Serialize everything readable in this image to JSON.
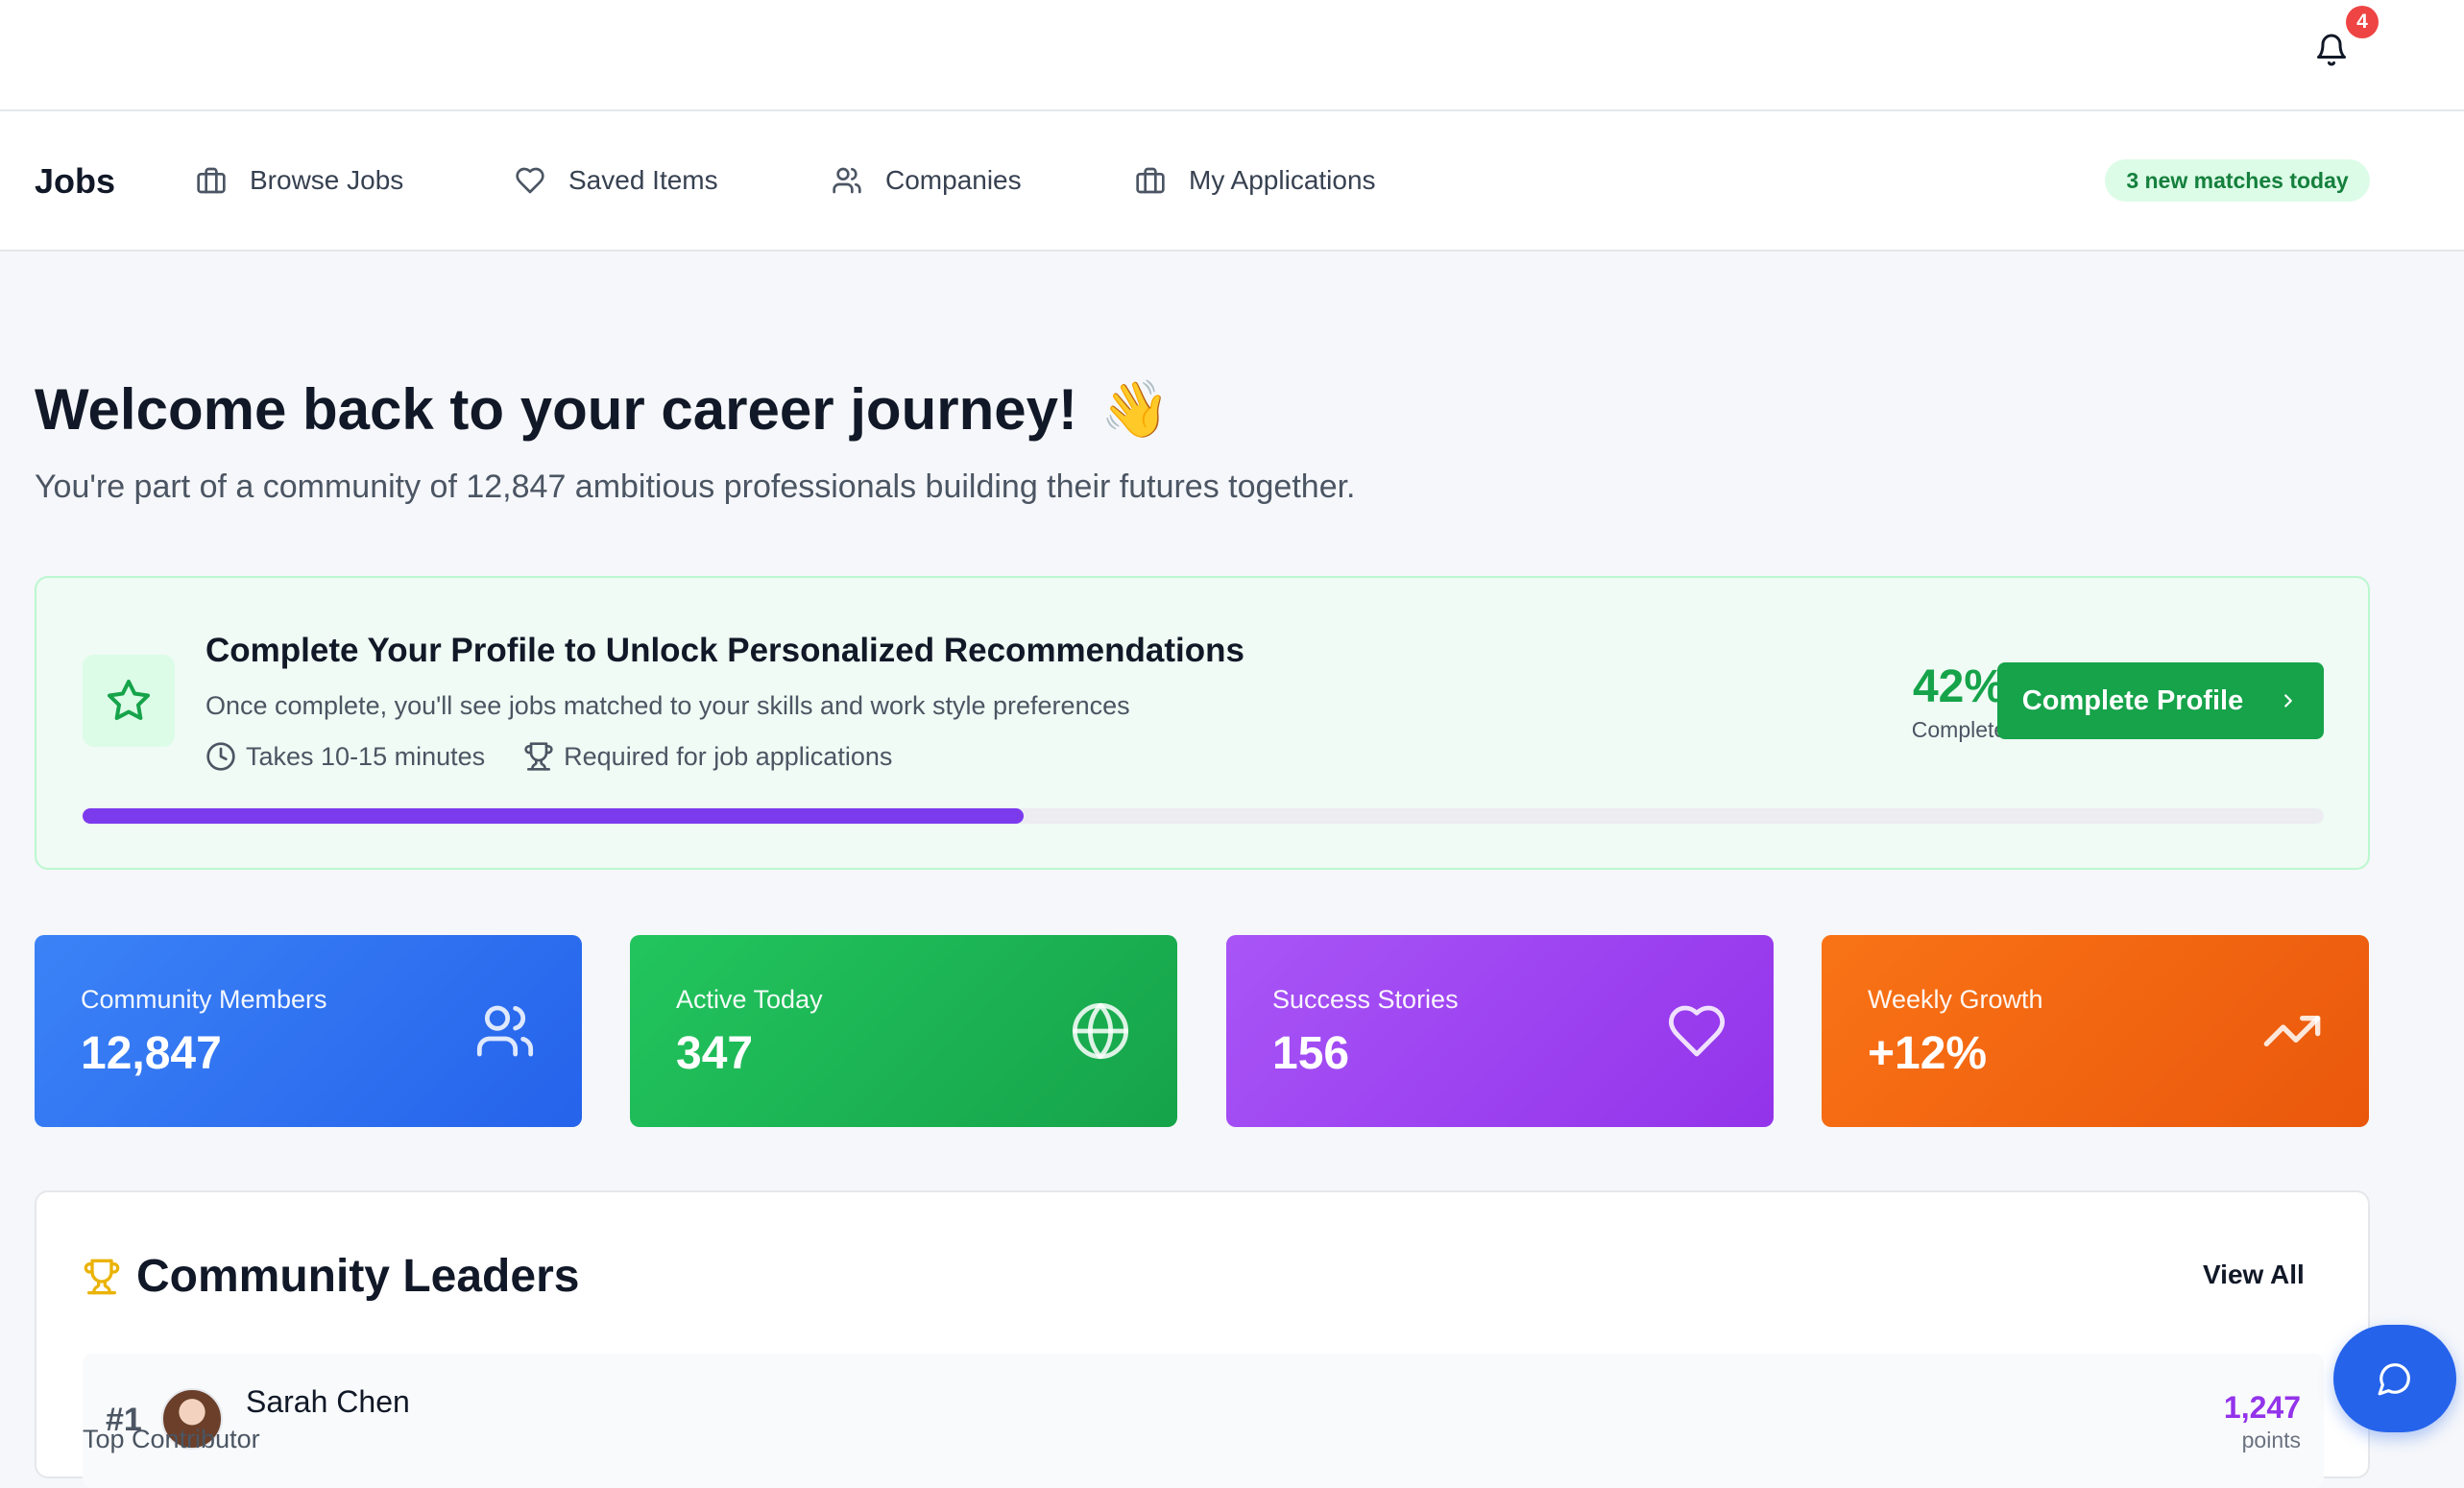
{
  "notifications": {
    "count": "4",
    "icon": "bell-icon"
  },
  "nav": {
    "brand": "Jobs",
    "items": [
      {
        "label": "Browse Jobs",
        "icon": "briefcase-icon"
      },
      {
        "label": "Saved Items",
        "icon": "heart-icon"
      },
      {
        "label": "Companies",
        "icon": "users-icon"
      },
      {
        "label": "My Applications",
        "icon": "briefcase-icon"
      }
    ],
    "matches_pill": "3 new matches today"
  },
  "hero": {
    "title": "Welcome back to your career journey!",
    "emoji": "👋",
    "subtitle": "You're part of a community of 12,847 ambitious professionals building their futures together."
  },
  "profile_card": {
    "icon": "star-icon",
    "title": "Complete Your Profile to Unlock Personalized Recommendations",
    "description": "Once complete, you'll see jobs matched to your skills and work style preferences",
    "meta": [
      {
        "icon": "clock-icon",
        "text": "Takes 10-15 minutes"
      },
      {
        "icon": "trophy-icon",
        "text": "Required for job applications"
      }
    ],
    "percent_value": "42%",
    "percent_label": "Complete",
    "progress": 0.42,
    "button_label": "Complete Profile"
  },
  "stats": [
    {
      "label": "Community Members",
      "value": "12,847",
      "icon": "users-icon"
    },
    {
      "label": "Active Today",
      "value": "347",
      "icon": "globe-icon"
    },
    {
      "label": "Success Stories",
      "value": "156",
      "icon": "heart-icon"
    },
    {
      "label": "Weekly Growth",
      "value": "+12%",
      "icon": "trending-up-icon"
    }
  ],
  "leaders": {
    "title": "Community Leaders",
    "view_all": "View All",
    "rows": [
      {
        "rank": "#1",
        "name": "Sarah Chen",
        "role": "Top Contributor",
        "points": "1,247",
        "points_label": "points"
      }
    ]
  },
  "colors": {
    "accent_green": "#16a34a",
    "progress_purple": "#7c3aed",
    "badge_red": "#ef4444",
    "chat_blue": "#2563eb"
  }
}
